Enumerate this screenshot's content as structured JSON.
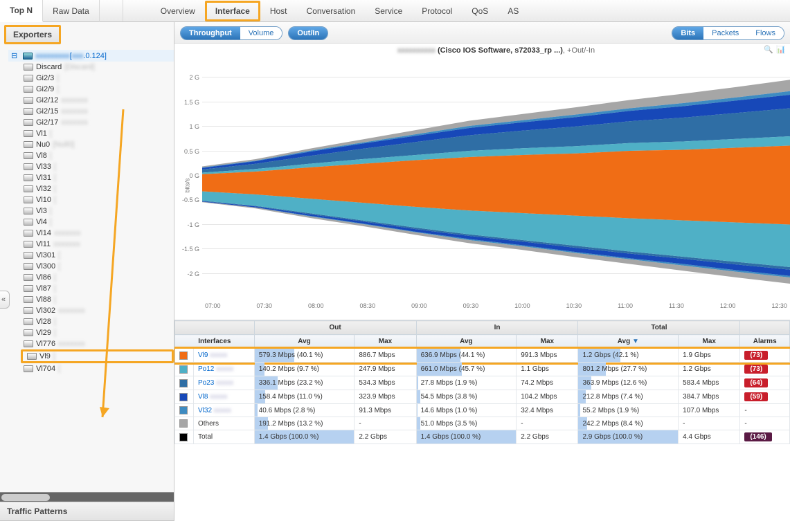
{
  "topnav": {
    "sidebar_tabs": [
      {
        "label": "Top N",
        "active": true
      },
      {
        "label": "Raw Data",
        "active": false
      }
    ],
    "main_tabs": [
      {
        "label": "Overview",
        "hl": false
      },
      {
        "label": "Interface",
        "hl": true
      },
      {
        "label": "Host",
        "hl": false
      },
      {
        "label": "Conversation",
        "hl": false
      },
      {
        "label": "Service",
        "hl": false
      },
      {
        "label": "Protocol",
        "hl": false
      },
      {
        "label": "QoS",
        "hl": false
      },
      {
        "label": "AS",
        "hl": false
      }
    ]
  },
  "sidebar": {
    "header": "Exporters",
    "root": {
      "label": "[",
      "addr": ".0.124]"
    },
    "nodes": [
      {
        "lbl": "Discard",
        "desc": "[Discard]",
        "hl": false
      },
      {
        "lbl": "Gi2/3",
        "desc": "[",
        "hl": false
      },
      {
        "lbl": "Gi2/9",
        "desc": "[",
        "hl": false
      },
      {
        "lbl": "Gi2/12",
        "desc": "",
        "hl": false
      },
      {
        "lbl": "Gi2/15",
        "desc": "",
        "hl": false
      },
      {
        "lbl": "Gi2/17",
        "desc": "",
        "hl": false
      },
      {
        "lbl": "Vl1",
        "desc": "[",
        "hl": false
      },
      {
        "lbl": "Nu0",
        "desc": "[Null0]",
        "hl": false
      },
      {
        "lbl": "Vl8",
        "desc": "[",
        "hl": false
      },
      {
        "lbl": "Vl33",
        "desc": "[",
        "hl": false
      },
      {
        "lbl": "Vl31",
        "desc": "[",
        "hl": false
      },
      {
        "lbl": "Vl32",
        "desc": "[",
        "hl": false
      },
      {
        "lbl": "Vl10",
        "desc": "[",
        "hl": false
      },
      {
        "lbl": "Vl3",
        "desc": "[",
        "hl": false
      },
      {
        "lbl": "Vl4",
        "desc": "[",
        "hl": false
      },
      {
        "lbl": "Vl14",
        "desc": "",
        "hl": false
      },
      {
        "lbl": "Vl11",
        "desc": "",
        "hl": false
      },
      {
        "lbl": "Vl301",
        "desc": "[",
        "hl": false
      },
      {
        "lbl": "Vl300",
        "desc": "[",
        "hl": false
      },
      {
        "lbl": "Vl86",
        "desc": "[",
        "hl": false
      },
      {
        "lbl": "Vl87",
        "desc": "[",
        "hl": false
      },
      {
        "lbl": "Vl88",
        "desc": "[",
        "hl": false
      },
      {
        "lbl": "Vl302",
        "desc": "",
        "hl": false
      },
      {
        "lbl": "Vl28",
        "desc": "[",
        "hl": false
      },
      {
        "lbl": "Vl29",
        "desc": "[",
        "hl": false
      },
      {
        "lbl": "Vl776",
        "desc": "",
        "hl": false
      },
      {
        "lbl": "Vl9",
        "desc": "[",
        "hl": true
      },
      {
        "lbl": "Vl704",
        "desc": "[",
        "hl": false
      }
    ],
    "bottom_header": "Traffic Patterns"
  },
  "subbar": {
    "measure": {
      "items": [
        "Throughput",
        "Volume"
      ],
      "active": 0
    },
    "direction": {
      "items": [
        "Out/In"
      ],
      "active": 0
    },
    "units": {
      "items": [
        "Bits",
        "Packets",
        "Flows"
      ],
      "active": 0
    }
  },
  "chart": {
    "title_suffix": "(Cisco IOS Software, s72033_rp ...)",
    "subtitle": ", +Out/-In",
    "ylabel": "bits/s",
    "yticks": [
      "2 G",
      "1.5 G",
      "1 G",
      "0.5 G",
      "0 G",
      "-0.5 G",
      "-1 G",
      "-1.5 G",
      "-2 G"
    ],
    "xticks": [
      "07:00",
      "07:30",
      "08:00",
      "08:30",
      "09:00",
      "09:30",
      "10:00",
      "10:30",
      "11:00",
      "11:30",
      "12:00",
      "12:30"
    ]
  },
  "chart_data": {
    "type": "area",
    "stacked": true,
    "xlabel": "time",
    "ylabel": "bits/s",
    "ylim": [
      -2.4,
      2.4
    ],
    "yunit": "G",
    "x": [
      "07:00",
      "07:30",
      "08:00",
      "08:30",
      "09:00",
      "09:30",
      "10:00",
      "10:30",
      "11:00",
      "11:30",
      "12:00",
      "12:30"
    ],
    "series": [
      {
        "name": "Vl9",
        "color": "#f06d15",
        "out": [
          0.15,
          0.2,
          0.28,
          0.35,
          0.42,
          0.48,
          0.52,
          0.55,
          0.6,
          0.62,
          0.66,
          0.7
        ],
        "in": [
          -0.18,
          -0.24,
          -0.32,
          -0.4,
          -0.48,
          -0.55,
          -0.6,
          -0.65,
          -0.7,
          -0.74,
          -0.78,
          -0.82
        ]
      },
      {
        "name": "Po12",
        "color": "#4fb0c6",
        "out": [
          0.03,
          0.05,
          0.07,
          0.09,
          0.1,
          0.12,
          0.13,
          0.14,
          0.15,
          0.16,
          0.17,
          0.18
        ],
        "in": [
          -0.18,
          -0.22,
          -0.28,
          -0.34,
          -0.4,
          -0.46,
          -0.52,
          -0.58,
          -0.64,
          -0.7,
          -0.76,
          -0.82
        ]
      },
      {
        "name": "Po23",
        "color": "#2f6ea5",
        "out": [
          0.06,
          0.1,
          0.15,
          0.2,
          0.25,
          0.3,
          0.34,
          0.38,
          0.42,
          0.46,
          0.5,
          0.54
        ],
        "in": [
          -0.01,
          -0.01,
          -0.02,
          -0.02,
          -0.03,
          -0.03,
          -0.03,
          -0.04,
          -0.04,
          -0.04,
          -0.05,
          -0.05
        ]
      },
      {
        "name": "Vl8",
        "color": "#1748b8",
        "out": [
          0.03,
          0.05,
          0.08,
          0.1,
          0.12,
          0.14,
          0.16,
          0.18,
          0.2,
          0.22,
          0.24,
          0.26
        ],
        "in": [
          -0.01,
          -0.02,
          -0.03,
          -0.04,
          -0.05,
          -0.06,
          -0.07,
          -0.08,
          -0.09,
          -0.1,
          -0.11,
          -0.12
        ]
      },
      {
        "name": "Vl32",
        "color": "#3e8bc1",
        "out": [
          0.01,
          0.01,
          0.02,
          0.02,
          0.03,
          0.04,
          0.04,
          0.05,
          0.05,
          0.06,
          0.06,
          0.07
        ],
        "in": [
          0,
          0,
          -0.01,
          -0.01,
          -0.01,
          -0.02,
          -0.02,
          -0.02,
          -0.02,
          -0.03,
          -0.03,
          -0.03
        ]
      },
      {
        "name": "Others",
        "color": "#a6a6a6",
        "out": [
          0.02,
          0.03,
          0.04,
          0.06,
          0.08,
          0.1,
          0.12,
          0.14,
          0.16,
          0.18,
          0.2,
          0.22
        ],
        "in": [
          -0.01,
          -0.02,
          -0.03,
          -0.04,
          -0.05,
          -0.06,
          -0.07,
          -0.08,
          -0.09,
          -0.1,
          -0.11,
          -0.12
        ]
      }
    ],
    "total": {
      "out": [
        0.3,
        0.44,
        0.64,
        0.82,
        1.0,
        1.18,
        1.31,
        1.44,
        1.58,
        1.7,
        1.83,
        1.97
      ],
      "in": [
        -0.39,
        -0.51,
        -0.69,
        -0.85,
        -1.02,
        -1.18,
        -1.31,
        -1.45,
        -1.58,
        -1.71,
        -1.84,
        -1.96
      ]
    }
  },
  "table": {
    "group_headers": [
      "",
      "Out",
      "In",
      "Total",
      ""
    ],
    "headers": [
      "Interfaces",
      "Avg",
      "Max",
      "Avg",
      "Max",
      "Avg",
      "Max",
      "Alarms"
    ],
    "sort_col": 5,
    "rows": [
      {
        "sw": "#f06d15",
        "iface": "Vl9",
        "out_avg": "579.3 Mbps (40.1 %)",
        "out_avg_p": 40.1,
        "out_max": "886.7 Mbps",
        "in_avg": "636.9 Mbps (44.1 %)",
        "in_avg_p": 44.1,
        "in_max": "991.3 Mbps",
        "tot_avg": "1.2 Gbps (42.1 %)",
        "tot_avg_p": 42.1,
        "tot_max": "1.9 Gbps",
        "alarm": "(73)",
        "aclr": "red",
        "hl": true
      },
      {
        "sw": "#4fb0c6",
        "iface": "Po12",
        "out_avg": "140.2 Mbps (9.7 %)",
        "out_avg_p": 9.7,
        "out_max": "247.9 Mbps",
        "in_avg": "661.0 Mbps (45.7 %)",
        "in_avg_p": 45.7,
        "in_max": "1.1 Gbps",
        "tot_avg": "801.2 Mbps (27.7 %)",
        "tot_avg_p": 27.7,
        "tot_max": "1.2 Gbps",
        "alarm": "(73)",
        "aclr": "red",
        "hl": false
      },
      {
        "sw": "#2f6ea5",
        "iface": "Po23",
        "out_avg": "336.1 Mbps (23.2 %)",
        "out_avg_p": 23.2,
        "out_max": "534.3 Mbps",
        "in_avg": "27.8 Mbps (1.9 %)",
        "in_avg_p": 1.9,
        "in_max": "74.2 Mbps",
        "tot_avg": "363.9 Mbps (12.6 %)",
        "tot_avg_p": 12.6,
        "tot_max": "583.4 Mbps",
        "alarm": "(64)",
        "aclr": "red",
        "hl": false
      },
      {
        "sw": "#1748b8",
        "iface": "Vl8",
        "out_avg": "158.4 Mbps (11.0 %)",
        "out_avg_p": 11.0,
        "out_max": "323.9 Mbps",
        "in_avg": "54.5 Mbps (3.8 %)",
        "in_avg_p": 3.8,
        "in_max": "104.2 Mbps",
        "tot_avg": "212.8 Mbps (7.4 %)",
        "tot_avg_p": 7.4,
        "tot_max": "384.7 Mbps",
        "alarm": "(59)",
        "aclr": "red",
        "hl": false
      },
      {
        "sw": "#3e8bc1",
        "iface": "Vl32",
        "out_avg": "40.6 Mbps (2.8 %)",
        "out_avg_p": 2.8,
        "out_max": "91.3 Mbps",
        "in_avg": "14.6 Mbps (1.0 %)",
        "in_avg_p": 1.0,
        "in_max": "32.4 Mbps",
        "tot_avg": "55.2 Mbps (1.9 %)",
        "tot_avg_p": 1.9,
        "tot_max": "107.0 Mbps",
        "alarm": "-",
        "aclr": "",
        "hl": false
      },
      {
        "sw": "#a6a6a6",
        "iface": "Others",
        "out_avg": "191.2 Mbps (13.2 %)",
        "out_avg_p": 13.2,
        "out_max": "-",
        "in_avg": "51.0 Mbps (3.5 %)",
        "in_avg_p": 3.5,
        "in_max": "-",
        "tot_avg": "242.2 Mbps (8.4 %)",
        "tot_avg_p": 8.4,
        "tot_max": "-",
        "alarm": "-",
        "aclr": "",
        "hl": false
      },
      {
        "sw": "#000",
        "iface": "Total",
        "out_avg": "1.4 Gbps (100.0 %)",
        "out_avg_p": 100,
        "out_max": "2.2 Gbps",
        "in_avg": "1.4 Gbps (100.0 %)",
        "in_avg_p": 100,
        "in_max": "2.2 Gbps",
        "tot_avg": "2.9 Gbps (100.0 %)",
        "tot_avg_p": 100,
        "tot_max": "4.4 Gbps",
        "alarm": "(146)",
        "aclr": "dk",
        "hl": false
      }
    ]
  },
  "collapse_glyph": "«"
}
